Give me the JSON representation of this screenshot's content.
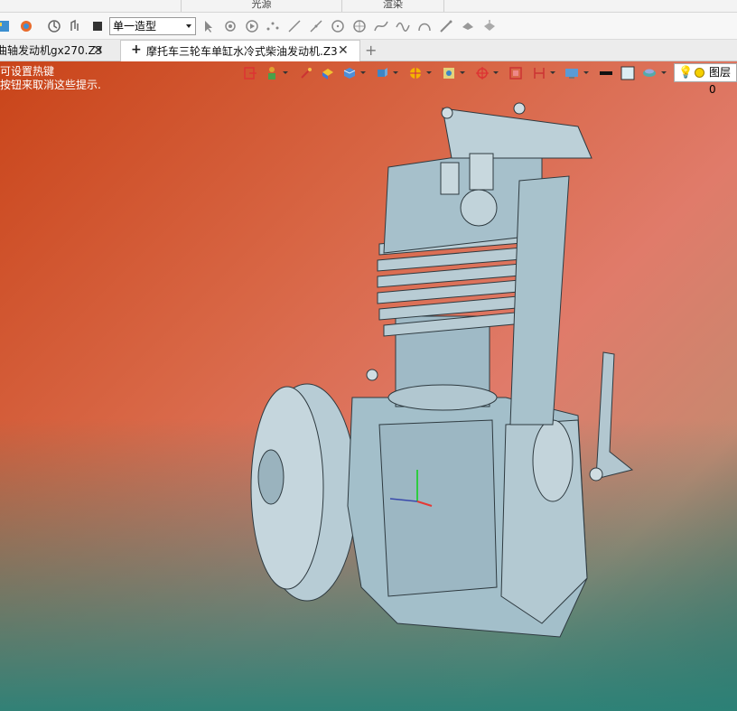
{
  "ribbon": {
    "group_captions": [
      "光源",
      "渲染"
    ]
  },
  "toolbar": {
    "mode_select_value": "单一造型",
    "icons": [
      "app-icon",
      "render-icon",
      "rotate-icon",
      "history-icon",
      "stop-icon",
      "select-arrow-icon",
      "pick-icon",
      "play-icon",
      "point-icon",
      "line-icon",
      "line2-icon",
      "circle-icon",
      "circle2-icon",
      "curve-icon",
      "wave-icon",
      "arc-icon",
      "pen-icon",
      "cloud-icon",
      "shade-icon"
    ]
  },
  "tabs": [
    {
      "label": "曲轴发动机gx270.Z3",
      "active": false
    },
    {
      "label": "摩托车三轮车单缸水冷式柴油发动机.Z3",
      "active": true
    }
  ],
  "viewport": {
    "hint_lines": [
      "可设置热键",
      "按钮来取消这些提示."
    ],
    "layer_label": "图层0"
  },
  "colors": {
    "model": "#a9c4cf",
    "model_edge": "#2e3a40",
    "bg_top_left": "#c94419",
    "bg_bottom": "#2e8278"
  }
}
